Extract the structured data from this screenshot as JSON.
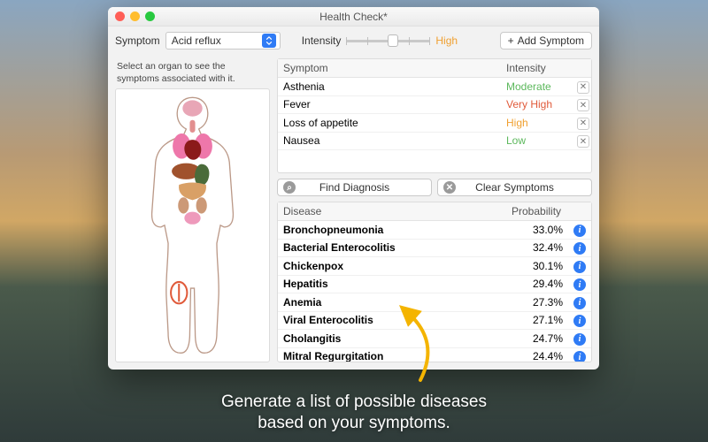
{
  "window": {
    "title": "Health Check*"
  },
  "toolbar": {
    "symptom_label": "Symptom",
    "symptom_value": "Acid reflux",
    "intensity_label": "Intensity",
    "intensity_value": "High",
    "intensity_color": "#f0a030",
    "add_label": "Add Symptom"
  },
  "hint": "Select an organ to see the symptoms associated with it.",
  "symptom_table": {
    "headers": {
      "symptom": "Symptom",
      "intensity": "Intensity"
    },
    "rows": [
      {
        "name": "Asthenia",
        "intensity": "Moderate",
        "cls": "c-moderate"
      },
      {
        "name": "Fever",
        "intensity": "Very High",
        "cls": "c-veryhigh"
      },
      {
        "name": "Loss of appetite",
        "intensity": "High",
        "cls": "c-high"
      },
      {
        "name": "Nausea",
        "intensity": "Low",
        "cls": "c-low"
      }
    ]
  },
  "actions": {
    "find": "Find Diagnosis",
    "clear": "Clear Symptoms"
  },
  "disease_table": {
    "headers": {
      "disease": "Disease",
      "prob": "Probability"
    },
    "rows": [
      {
        "name": "Bronchopneumonia",
        "prob": "33.0%"
      },
      {
        "name": "Bacterial Enterocolitis",
        "prob": "32.4%"
      },
      {
        "name": "Chickenpox",
        "prob": "30.1%"
      },
      {
        "name": "Hepatitis",
        "prob": "29.4%"
      },
      {
        "name": "Anemia",
        "prob": "27.3%"
      },
      {
        "name": "Viral Enterocolitis",
        "prob": "27.1%"
      },
      {
        "name": "Cholangitis",
        "prob": "24.7%"
      },
      {
        "name": "Mitral Regurgitation",
        "prob": "24.4%"
      }
    ]
  },
  "caption": {
    "line1": "Generate a list of possible diseases",
    "line2": "based on your symptoms."
  }
}
